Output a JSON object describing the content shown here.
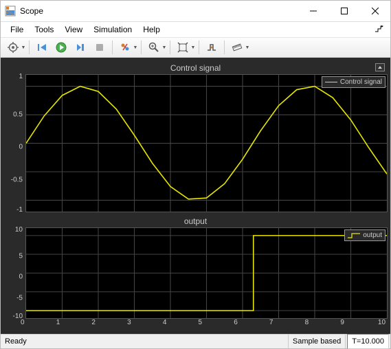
{
  "window": {
    "title": "Scope",
    "minimize_tip": "Minimize",
    "maximize_tip": "Maximize",
    "close_tip": "Close"
  },
  "menu": {
    "file": "File",
    "tools": "Tools",
    "view": "View",
    "simulation": "Simulation",
    "help": "Help"
  },
  "toolbar": {
    "config": "Configuration Properties",
    "restart": "Restart",
    "run": "Run",
    "step": "Step Forward",
    "stop": "Stop",
    "highlight": "Highlight Signal",
    "zoom": "Zoom",
    "autoscale": "Scale Axes",
    "triggers": "Triggers",
    "measure": "Measurements"
  },
  "status": {
    "ready": "Ready",
    "mode": "Sample based",
    "time": "T=10.000"
  },
  "plot_colors": {
    "signal": "#e6e600"
  },
  "chart_data": [
    {
      "type": "line",
      "title": "Control signal",
      "legend": [
        "Control signal"
      ],
      "xlabel": "",
      "ylabel": "",
      "xlim": [
        0,
        10
      ],
      "ylim": [
        -1.2,
        1.2
      ],
      "xticks": [
        0,
        1,
        2,
        3,
        4,
        5,
        6,
        7,
        8,
        9,
        10
      ],
      "yticks": [
        -1,
        -0.5,
        0,
        0.5,
        1
      ],
      "series": [
        {
          "name": "Control signal",
          "x": [
            0,
            0.5,
            1,
            1.5,
            2,
            2.5,
            3,
            3.5,
            4,
            4.5,
            5,
            5.5,
            6,
            6.5,
            7,
            7.5,
            8,
            8.5,
            9,
            9.5,
            10
          ],
          "y": [
            0,
            0.48,
            0.84,
            1.0,
            0.91,
            0.6,
            0.14,
            -0.35,
            -0.76,
            -0.98,
            -0.96,
            -0.71,
            -0.28,
            0.22,
            0.66,
            0.94,
            1.0,
            0.8,
            0.41,
            -0.08,
            -0.54
          ]
        }
      ]
    },
    {
      "type": "line",
      "title": "output",
      "legend": [
        "output"
      ],
      "xlabel": "",
      "ylabel": "",
      "xlim": [
        0,
        10
      ],
      "ylim": [
        -12,
        12
      ],
      "xticks": [
        0,
        1,
        2,
        3,
        4,
        5,
        6,
        7,
        8,
        9,
        10
      ],
      "yticks": [
        -10,
        -5,
        0,
        5,
        10
      ],
      "series": [
        {
          "name": "output",
          "x": [
            0,
            6.3,
            6.3,
            10
          ],
          "y": [
            -10,
            -10,
            10,
            10
          ]
        }
      ]
    }
  ]
}
